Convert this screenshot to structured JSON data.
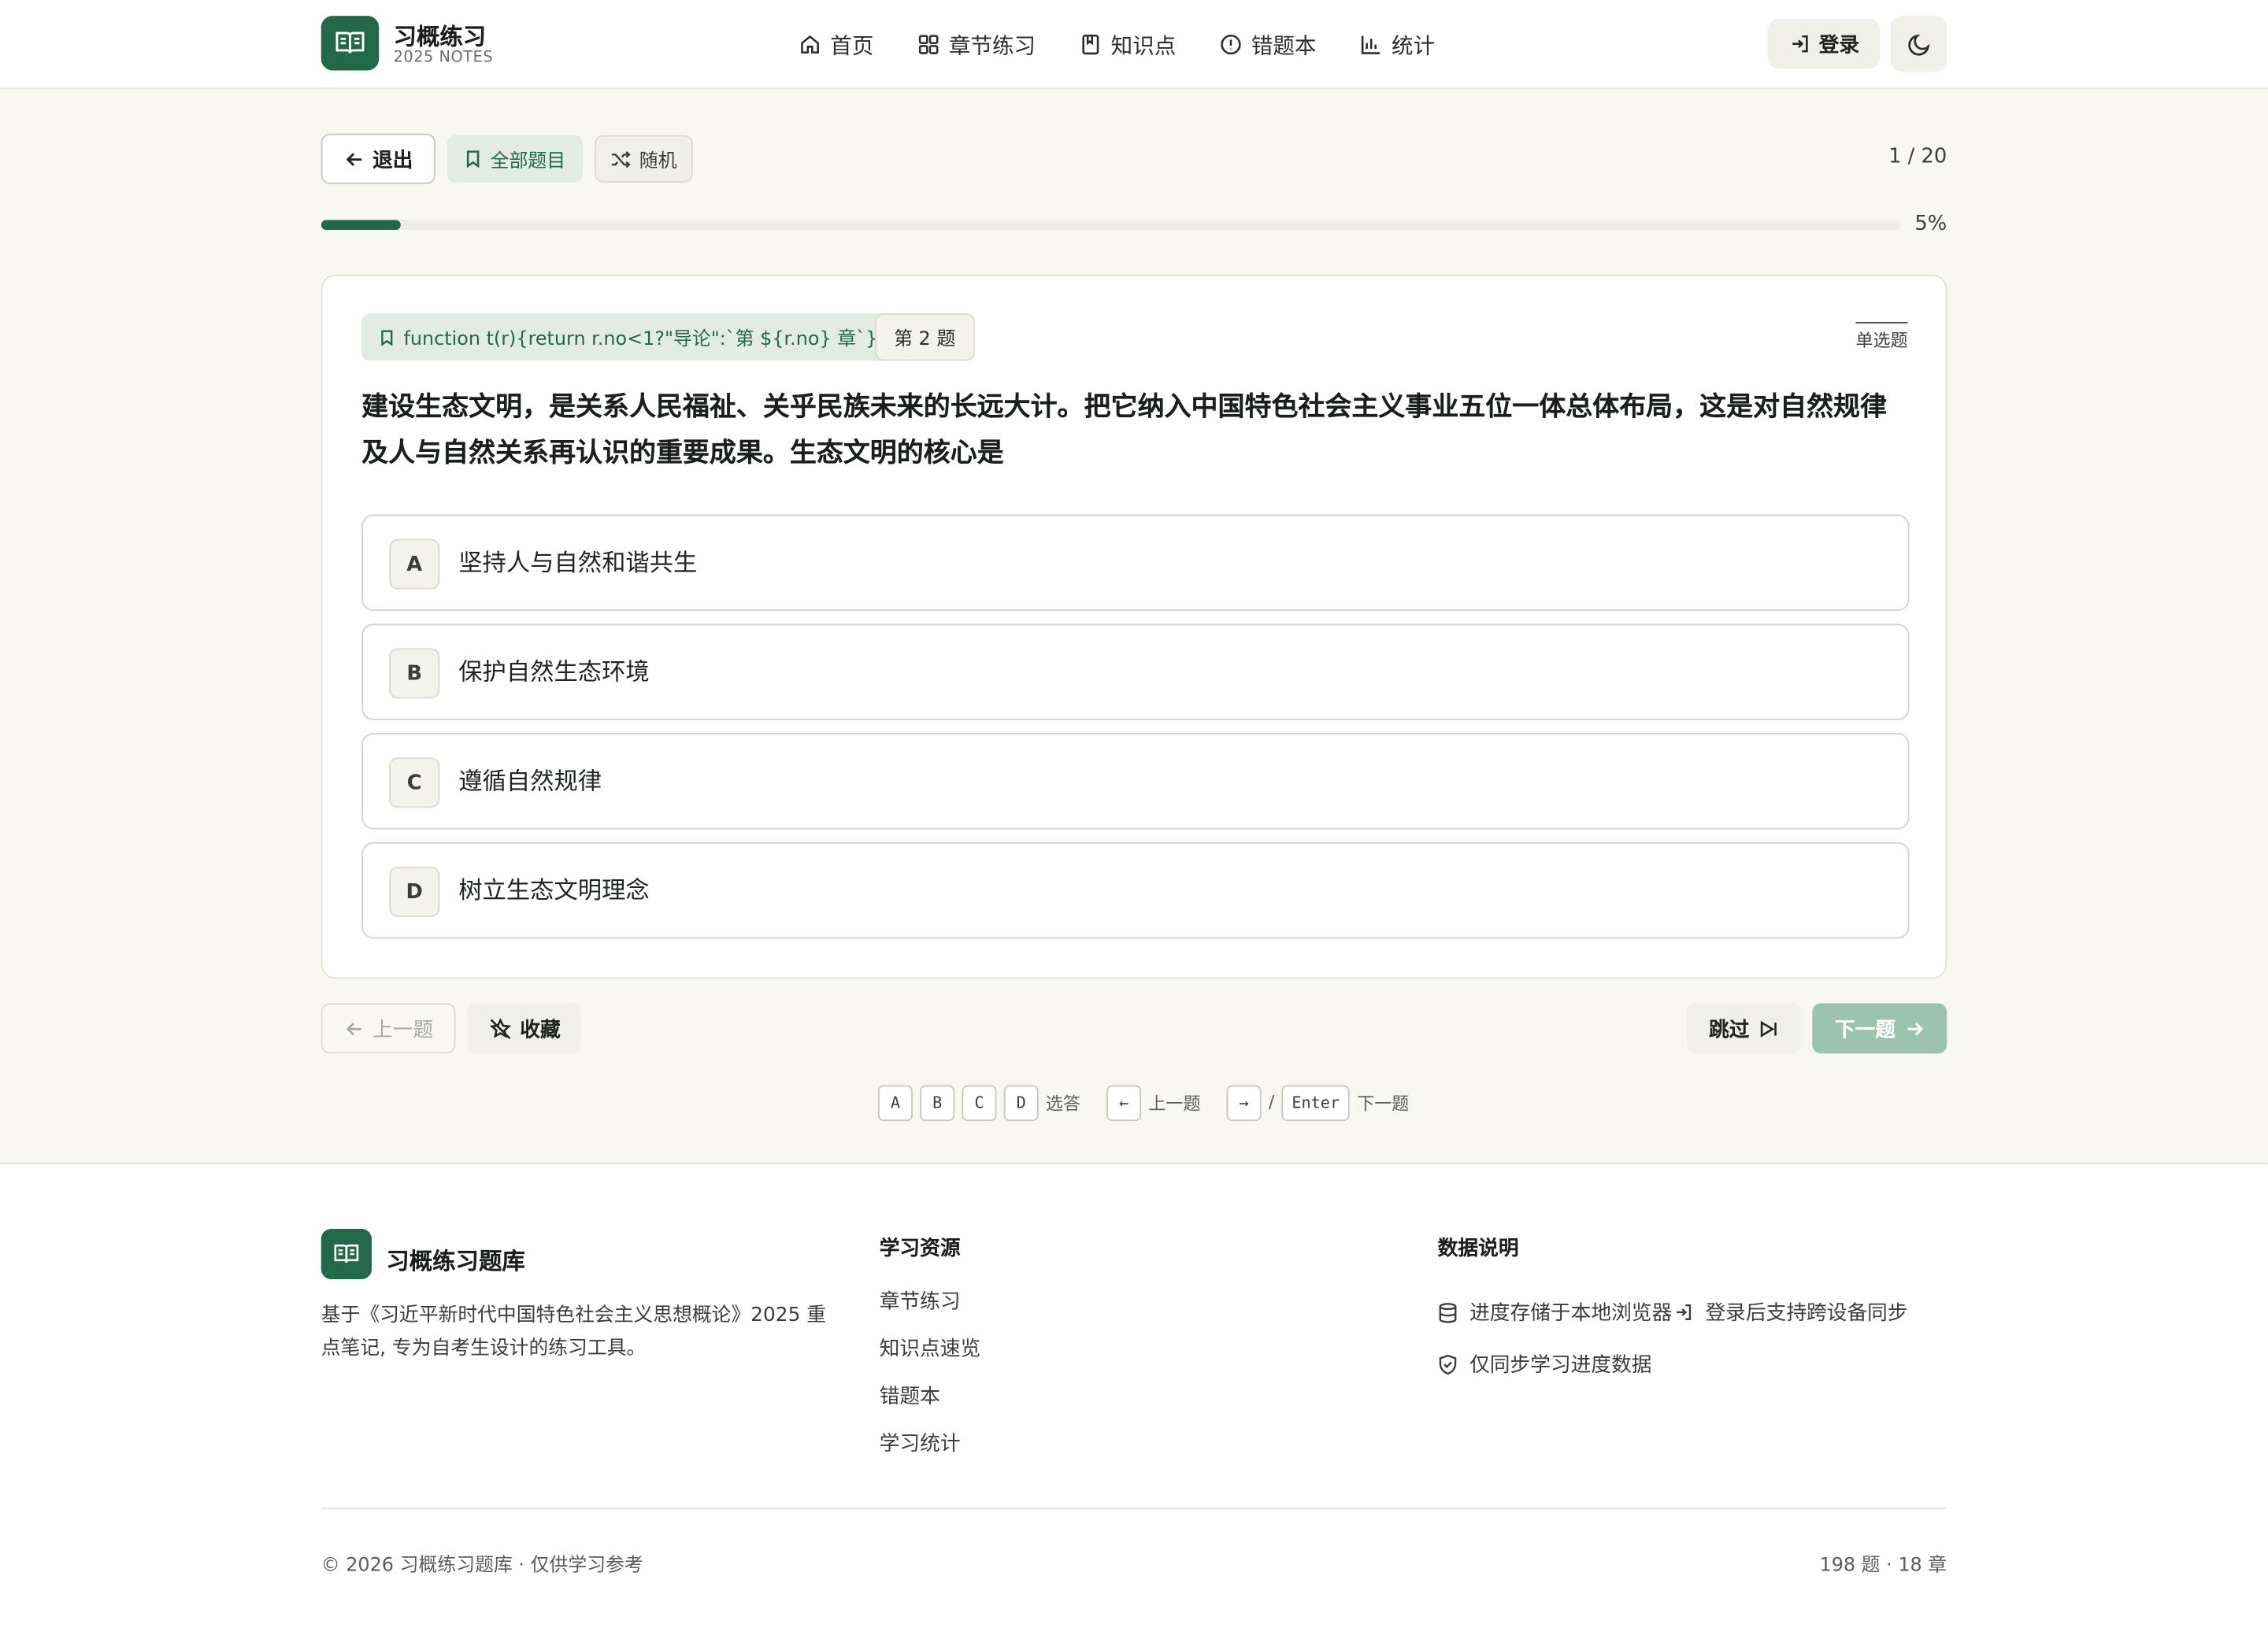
{
  "header": {
    "app_title": "习概练习",
    "app_subtitle": "2025 NOTES",
    "nav": [
      {
        "label": "首页",
        "icon": "home-icon"
      },
      {
        "label": "章节练习",
        "icon": "grid-icon"
      },
      {
        "label": "知识点",
        "icon": "bookmark-book-icon"
      },
      {
        "label": "错题本",
        "icon": "alert-circle-icon"
      },
      {
        "label": "统计",
        "icon": "bar-chart-icon"
      }
    ],
    "login_label": "登录",
    "theme_icon": "moon-icon"
  },
  "toolbar": {
    "exit_label": "退出",
    "all_label": "全部题目",
    "random_label": "随机",
    "counter": "1 / 20"
  },
  "progress": {
    "fraction": 0.05,
    "label": "5%"
  },
  "question": {
    "chapter_tag": "function t(r){return r.no<1?\"导论\":`第 ${r.no} 章`}",
    "number_tag": "第 2 题",
    "type": "单选题",
    "stem": "建设生态文明，是关系人民福祉、关乎民族未来的长远大计。把它纳入中国特色社会主义事业五位一体总体布局，这是对自然规律及人与自然关系再认识的重要成果。生态文明的核心是",
    "options": [
      {
        "key": "A",
        "text": "坚持人与自然和谐共生"
      },
      {
        "key": "B",
        "text": "保护自然生态环境"
      },
      {
        "key": "C",
        "text": "遵循自然规律"
      },
      {
        "key": "D",
        "text": "树立生态文明理念"
      }
    ]
  },
  "actions": {
    "prev_label": "上一题",
    "favorite_label": "收藏",
    "skip_label": "跳过",
    "next_label": "下一题"
  },
  "shortcuts": {
    "keys": [
      "A",
      "B",
      "C",
      "D"
    ],
    "choose_label": "选答",
    "prev_key": "←",
    "prev_label": "上一题",
    "next_key": "→",
    "separator": "/",
    "enter_key": "Enter",
    "next_label": "下一题"
  },
  "footer": {
    "brand": "习概练习题库",
    "description": "基于《习近平新时代中国特色社会主义思想概论》2025 重点笔记, 专为自考生设计的练习工具。",
    "resources_heading": "学习资源",
    "resources": [
      "章节练习",
      "知识点速览",
      "错题本",
      "学习统计"
    ],
    "data_heading": "数据说明",
    "data_note_1": "进度存储于本地浏览器",
    "data_note_1b": "登录后支持跨设备同步",
    "data_note_2": "仅同步学习进度数据",
    "copyright": "© 2026 习概练习题库 · 仅供学习参考",
    "stats": "198 题 · 18 章"
  },
  "colors": {
    "brand": "#236848",
    "brand_light": "#e3ece4",
    "next_disabled": "#9cc3ad",
    "page_bg": "#f9f7f2"
  }
}
